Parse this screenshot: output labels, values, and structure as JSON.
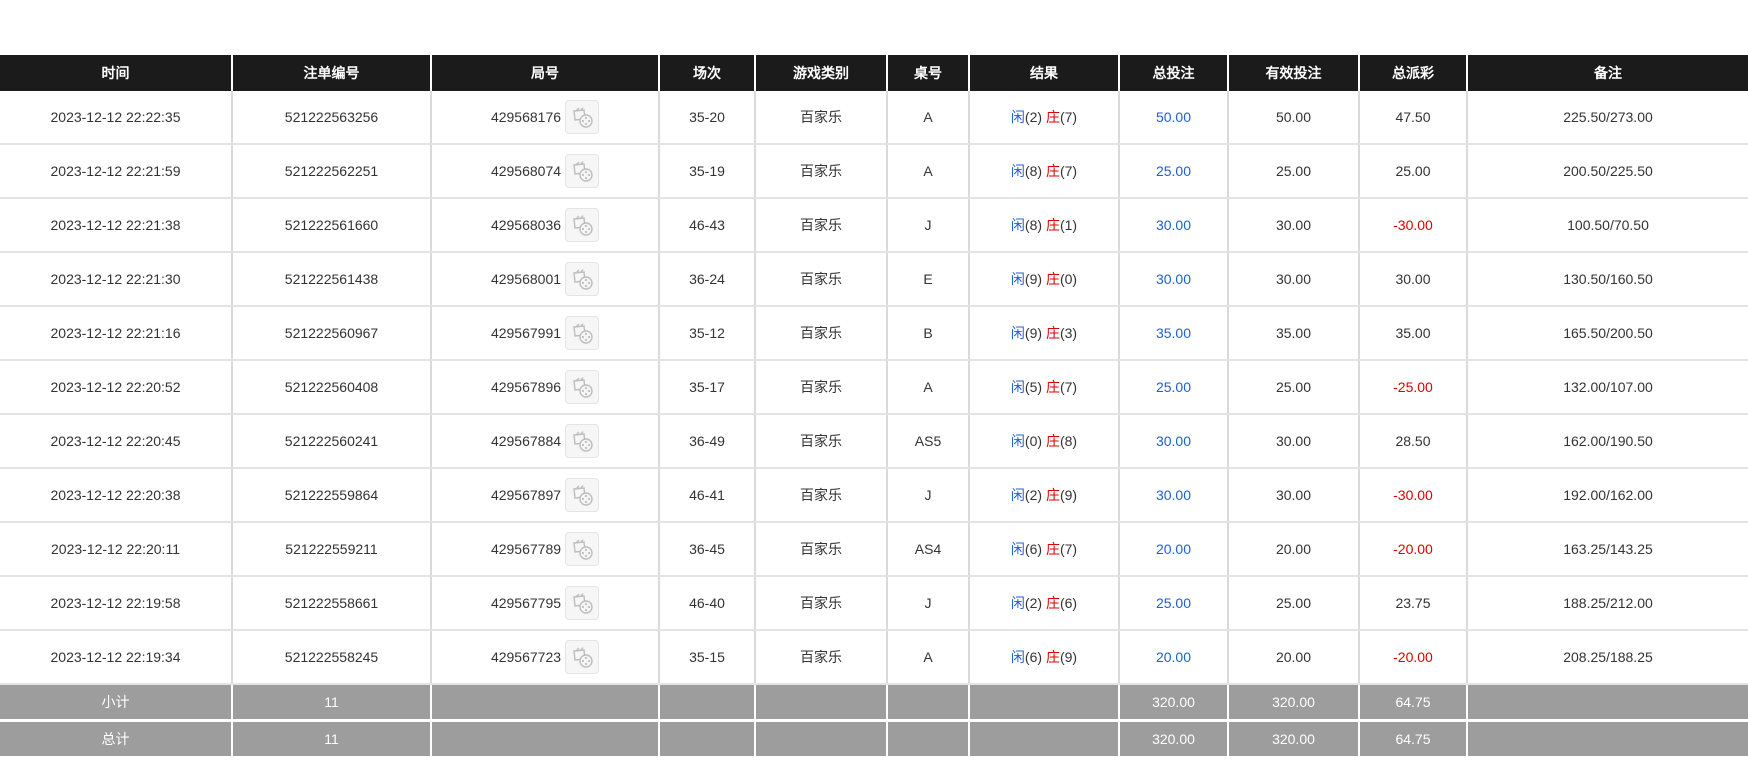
{
  "table": {
    "headers": [
      "时间",
      "注单编号",
      "局号",
      "场次",
      "游戏类别",
      "桌号",
      "结果",
      "总投注",
      "有效投注",
      "总派彩",
      "备注"
    ],
    "rows": [
      {
        "time": "2023-12-12 22:22:35",
        "bet_id": "521222563256",
        "round": "429568176",
        "session": "35-20",
        "game": "百家乐",
        "table": "A",
        "player_label": "闲",
        "player_score": "(2)",
        "banker_label": "庄",
        "banker_score": "(7)",
        "total_bet": "50.00",
        "valid_bet": "50.00",
        "payout": "47.50",
        "remark": "225.50/273.00"
      },
      {
        "time": "2023-12-12 22:21:59",
        "bet_id": "521222562251",
        "round": "429568074",
        "session": "35-19",
        "game": "百家乐",
        "table": "A",
        "player_label": "闲",
        "player_score": "(8)",
        "banker_label": "庄",
        "banker_score": "(7)",
        "total_bet": "25.00",
        "valid_bet": "25.00",
        "payout": "25.00",
        "remark": "200.50/225.50"
      },
      {
        "time": "2023-12-12 22:21:38",
        "bet_id": "521222561660",
        "round": "429568036",
        "session": "46-43",
        "game": "百家乐",
        "table": "J",
        "player_label": "闲",
        "player_score": "(8)",
        "banker_label": "庄",
        "banker_score": "(1)",
        "total_bet": "30.00",
        "valid_bet": "30.00",
        "payout": "-30.00",
        "remark": "100.50/70.50"
      },
      {
        "time": "2023-12-12 22:21:30",
        "bet_id": "521222561438",
        "round": "429568001",
        "session": "36-24",
        "game": "百家乐",
        "table": "E",
        "player_label": "闲",
        "player_score": "(9)",
        "banker_label": "庄",
        "banker_score": "(0)",
        "total_bet": "30.00",
        "valid_bet": "30.00",
        "payout": "30.00",
        "remark": "130.50/160.50"
      },
      {
        "time": "2023-12-12 22:21:16",
        "bet_id": "521222560967",
        "round": "429567991",
        "session": "35-12",
        "game": "百家乐",
        "table": "B",
        "player_label": "闲",
        "player_score": "(9)",
        "banker_label": "庄",
        "banker_score": "(3)",
        "total_bet": "35.00",
        "valid_bet": "35.00",
        "payout": "35.00",
        "remark": "165.50/200.50"
      },
      {
        "time": "2023-12-12 22:20:52",
        "bet_id": "521222560408",
        "round": "429567896",
        "session": "35-17",
        "game": "百家乐",
        "table": "A",
        "player_label": "闲",
        "player_score": "(5)",
        "banker_label": "庄",
        "banker_score": "(7)",
        "total_bet": "25.00",
        "valid_bet": "25.00",
        "payout": "-25.00",
        "remark": "132.00/107.00"
      },
      {
        "time": "2023-12-12 22:20:45",
        "bet_id": "521222560241",
        "round": "429567884",
        "session": "36-49",
        "game": "百家乐",
        "table": "AS5",
        "player_label": "闲",
        "player_score": "(0)",
        "banker_label": "庄",
        "banker_score": "(8)",
        "total_bet": "30.00",
        "valid_bet": "30.00",
        "payout": "28.50",
        "remark": "162.00/190.50"
      },
      {
        "time": "2023-12-12 22:20:38",
        "bet_id": "521222559864",
        "round": "429567897",
        "session": "46-41",
        "game": "百家乐",
        "table": "J",
        "player_label": "闲",
        "player_score": "(2)",
        "banker_label": "庄",
        "banker_score": "(9)",
        "total_bet": "30.00",
        "valid_bet": "30.00",
        "payout": "-30.00",
        "remark": "192.00/162.00"
      },
      {
        "time": "2023-12-12 22:20:11",
        "bet_id": "521222559211",
        "round": "429567789",
        "session": "36-45",
        "game": "百家乐",
        "table": "AS4",
        "player_label": "闲",
        "player_score": "(6)",
        "banker_label": "庄",
        "banker_score": "(7)",
        "total_bet": "20.00",
        "valid_bet": "20.00",
        "payout": "-20.00",
        "remark": "163.25/143.25"
      },
      {
        "time": "2023-12-12 22:19:58",
        "bet_id": "521222558661",
        "round": "429567795",
        "session": "46-40",
        "game": "百家乐",
        "table": "J",
        "player_label": "闲",
        "player_score": "(2)",
        "banker_label": "庄",
        "banker_score": "(6)",
        "total_bet": "25.00",
        "valid_bet": "25.00",
        "payout": "23.75",
        "remark": "188.25/212.00"
      },
      {
        "time": "2023-12-12 22:19:34",
        "bet_id": "521222558245",
        "round": "429567723",
        "session": "35-15",
        "game": "百家乐",
        "table": "A",
        "player_label": "闲",
        "player_score": "(6)",
        "banker_label": "庄",
        "banker_score": "(9)",
        "total_bet": "20.00",
        "valid_bet": "20.00",
        "payout": "-20.00",
        "remark": "208.25/188.25"
      }
    ],
    "summary": [
      {
        "label": "小计",
        "count": "11",
        "total_bet": "320.00",
        "valid_bet": "320.00",
        "payout": "64.75"
      },
      {
        "label": "总计",
        "count": "11",
        "total_bet": "320.00",
        "valid_bet": "320.00",
        "payout": "64.75"
      }
    ]
  },
  "icons": {
    "replay": "video-replay-icon"
  },
  "colors": {
    "header_bg": "#1b1b1b",
    "summary_bg": "#9d9d9d",
    "bet_blue": "#1f5fd1",
    "loss_red": "#e00000"
  }
}
